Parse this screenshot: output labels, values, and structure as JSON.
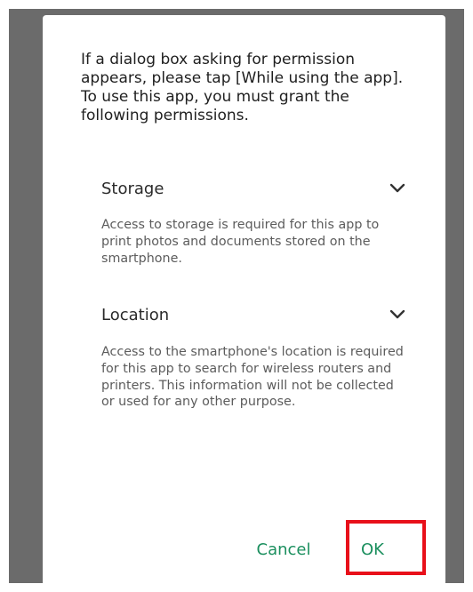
{
  "dialog": {
    "message": "If a dialog box asking for permission appears, please tap [While using the app]. To use this app, you must grant the following permissions.",
    "sections": [
      {
        "title": "Storage",
        "icon": "chevron-down-icon",
        "description": "Access to storage is required for this app to print photos and documents stored on the smartphone."
      },
      {
        "title": "Location",
        "icon": "chevron-down-icon",
        "description": "Access to the smartphone's location is required for this app to search for wireless routers and printers. This information will not be collected or used for any other purpose."
      }
    ],
    "buttons": {
      "cancel": "Cancel",
      "ok": "OK"
    }
  },
  "colors": {
    "accent": "#1b8f5e",
    "highlight": "#e8101a",
    "scrim": "#6b6b6b"
  }
}
